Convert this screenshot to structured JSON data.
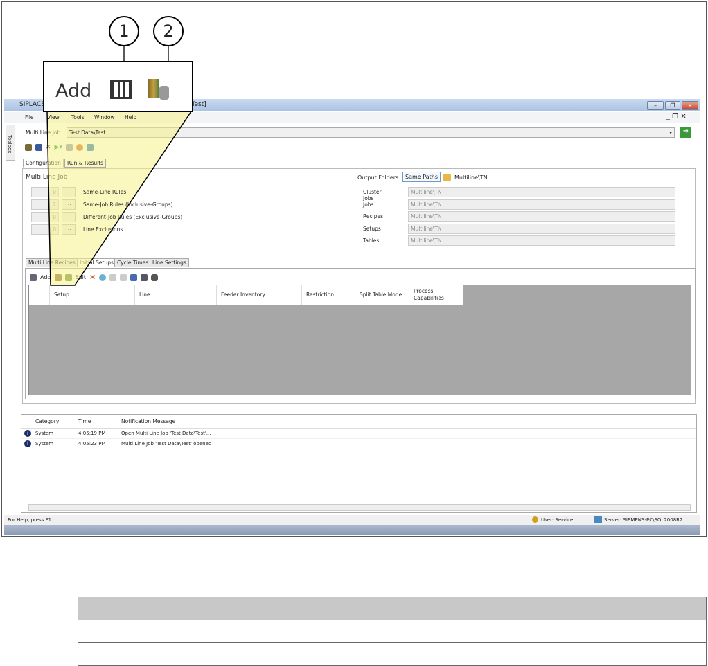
{
  "callout": {
    "add_label": "Add",
    "markers": [
      "1",
      "2"
    ]
  },
  "window": {
    "title_left": "SIPLACE",
    "title_right": "a\\Test]",
    "minimize": "–",
    "restore": "❐",
    "close": "✕"
  },
  "menu": [
    "File",
    "View",
    "Tools",
    "Window",
    "Help"
  ],
  "toolbox": "Toolbox",
  "job": {
    "label": "Multi Line Job:",
    "value": "Test Data\\Test"
  },
  "tabs": [
    "Configuration",
    "Run & Results"
  ],
  "multi_line_job": {
    "heading": "Multi Line Job",
    "rules": [
      {
        "count": "0",
        "button": "...",
        "label": "Same-Line Rules"
      },
      {
        "count": "2",
        "button": "...",
        "label": "Same-Job Rules (Inclusive-Groups)"
      },
      {
        "count": "0",
        "button": "...",
        "label": "Different-Job Rules (Exclusive-Groups)"
      },
      {
        "count": "0",
        "button": "...",
        "label": "Line Exclusions"
      }
    ]
  },
  "output": {
    "heading": "Output Folders",
    "same_paths": "Same Paths",
    "path": "Multiline\\TN",
    "rows": [
      {
        "label": "Cluster Jobs",
        "value": "Multiline\\TN"
      },
      {
        "label": "Jobs",
        "value": "Multiline\\TN"
      },
      {
        "label": "Recipes",
        "value": "Multiline\\TN"
      },
      {
        "label": "Setups",
        "value": "Multiline\\TN"
      },
      {
        "label": "Tables",
        "value": "Multiline\\TN"
      }
    ]
  },
  "subtabs": [
    "Multi Line Recipes",
    "Initial Setups",
    "Cycle Times",
    "Line Settings"
  ],
  "subtoolbar": {
    "add": "Add",
    "edit": "Edit"
  },
  "grid_columns": [
    "Setup",
    "Line",
    "Feeder Inventory",
    "Restriction",
    "Split Table Mode",
    "Process Capabilities"
  ],
  "log": {
    "columns": [
      "Category",
      "Time",
      "Notification Message"
    ],
    "rows": [
      {
        "category": "System",
        "time": "4:05:19 PM",
        "message": "Open Multi Line Job 'Test Data\\Test'..."
      },
      {
        "category": "System",
        "time": "4:05:23 PM",
        "message": "Multi Line Job 'Test Data\\Test' opened"
      }
    ]
  },
  "status": {
    "help": "For Help, press F1",
    "user": "User: Service",
    "server": "Server: SIEMENS-PC\\SQL2008R2"
  }
}
